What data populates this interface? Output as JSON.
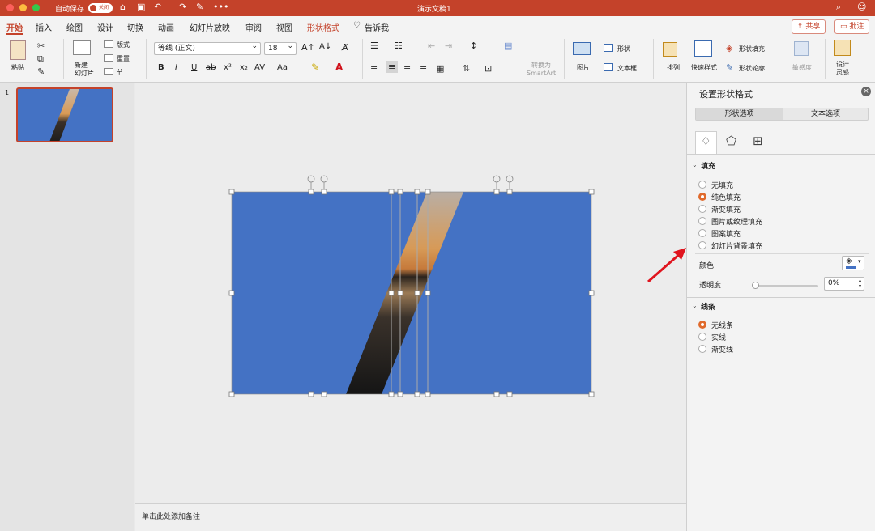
{
  "titlebar": {
    "autosave_label": "自动保存",
    "autosave_state": "关闭",
    "doc_title": "演示文稿1",
    "more": "•••"
  },
  "tabs": [
    "开始",
    "插入",
    "绘图",
    "设计",
    "切换",
    "动画",
    "幻灯片放映",
    "审阅",
    "视图",
    "形状格式"
  ],
  "tell_me": "告诉我",
  "share_label": "共享",
  "comments_label": "批注",
  "ribbon": {
    "paste": "粘贴",
    "new_slide": "新建\n幻灯片",
    "layout": "版式",
    "reset": "重置",
    "section": "节",
    "font_name": "等线 (正文)",
    "font_size": "18",
    "convert_smartart": "转换为\nSmartArt",
    "picture": "图片",
    "shape": "形状",
    "textbox": "文本框",
    "arrange": "排列",
    "quick_styles": "快速样式",
    "shape_fill": "形状填充",
    "shape_outline": "形状轮廓",
    "sensitivity": "敏感度",
    "designer": "设计\n灵感",
    "bold": "B",
    "italic": "I",
    "underline": "U",
    "strike": "ab",
    "sup": "x²",
    "sub": "x₂",
    "spacing": "AV",
    "case": "Aa"
  },
  "slide_panel": {
    "slide_number": "1"
  },
  "notes_placeholder": "单击此处添加备注",
  "format_pane": {
    "title": "设置形状格式",
    "tab_shape": "形状选项",
    "tab_text": "文本选项",
    "fill_section": "填充",
    "fill_options": [
      "无填充",
      "纯色填充",
      "渐变填充",
      "图片或纹理填充",
      "图案填充",
      "幻灯片背景填充"
    ],
    "fill_selected": 1,
    "color_label": "颜色",
    "transparency_label": "透明度",
    "transparency_value": "0%",
    "transparency_fraction": 0,
    "line_section": "线条",
    "line_options": [
      "无线条",
      "实线",
      "渐变线"
    ],
    "line_selected": 0
  },
  "colors": {
    "accent": "#c4422a",
    "slide_fill": "#4472c4",
    "radio_on": "#e06a2c"
  }
}
